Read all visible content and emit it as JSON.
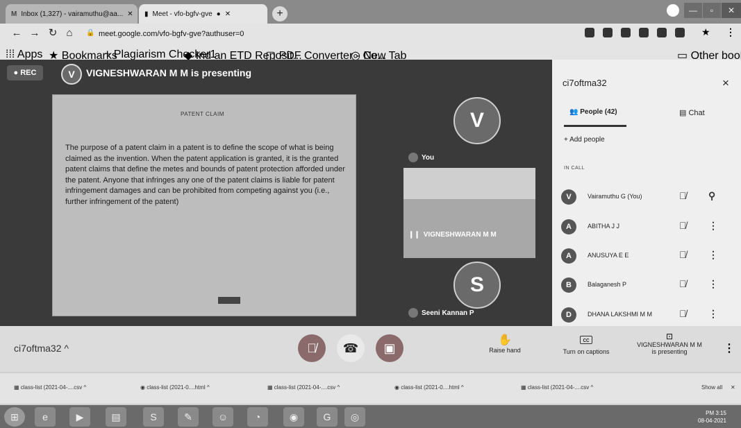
{
  "browser": {
    "tabs": [
      {
        "label": "Inbox (1,327) - vairamuthu@aa...",
        "icon": "gmail-icon"
      },
      {
        "label": "Meet - vfo-bgfv-gve",
        "icon": "meet-icon"
      }
    ],
    "url": "meet.google.com/vfo-bgfv-gve?authuser=0",
    "bookmarks": [
      "Apps",
      "Bookmarks",
      "Plagiarism Checker1",
      "Ind an ETD Reposit...",
      "PDF Converter - Co...",
      "New Tab",
      "Other bookmarks"
    ]
  },
  "meet": {
    "rec_label": "REC",
    "presenter_initial": "V",
    "presenting_title": "VIGNESHWARAN M M is presenting",
    "slide": {
      "title": "PATENT CLAIM",
      "body": "The purpose of a patent claim in a patent is to define the scope of what is being claimed as the invention. When the patent application is granted, it is the granted patent claims that define the metes and bounds of patent protection afforded under the patent.  Anyone that infringes any one of the patent claims is liable for patent infringement damages and can be prohibited from competing against you (i.e., further infringement of the patent)"
    },
    "tiles": [
      {
        "initial": "V",
        "label": "You"
      },
      {
        "label": "VIGNESHWARAN M M"
      },
      {
        "initial": "S",
        "label": "Seeni Kannan P"
      }
    ]
  },
  "panel": {
    "meeting_code": "ci7oftma32",
    "close": "×",
    "tab_people": "People (42)",
    "tab_chat": "Chat",
    "add_people": "Add people",
    "in_call": "IN CALL",
    "participants": [
      {
        "initial": "V",
        "name": "Vairamuthu G (You)",
        "mic": "mic-off-icon",
        "action": "pin-icon"
      },
      {
        "initial": "A",
        "name": "ABITHA J J",
        "mic": "mic-off-icon",
        "action": "more-icon"
      },
      {
        "initial": "A",
        "name": "ANUSUYA E E",
        "mic": "mic-off-icon",
        "action": "more-icon"
      },
      {
        "initial": "B",
        "name": "Balaganesh P",
        "mic": "mic-off-icon",
        "action": "more-icon"
      },
      {
        "initial": "D",
        "name": "DHANA LAKSHMI M M",
        "mic": "mic-off-icon",
        "action": "more-icon"
      }
    ]
  },
  "controls": {
    "meeting_code": "ci7oftma32",
    "raise_hand": "Raise hand",
    "captions": "Turn on captions",
    "presenting_line1": "VIGNESHWARAN M M",
    "presenting_line2": "is presenting"
  },
  "downloads": {
    "items": [
      "class-list (2021-04-....csv",
      "class-list (2021-0....html",
      "class-list (2021-04-....csv",
      "class-list (2021-0....html",
      "class-list (2021-04-....csv"
    ],
    "show_all": "Show all"
  },
  "taskbar": {
    "time": "PM 3:15",
    "date": "08-04-2021"
  }
}
